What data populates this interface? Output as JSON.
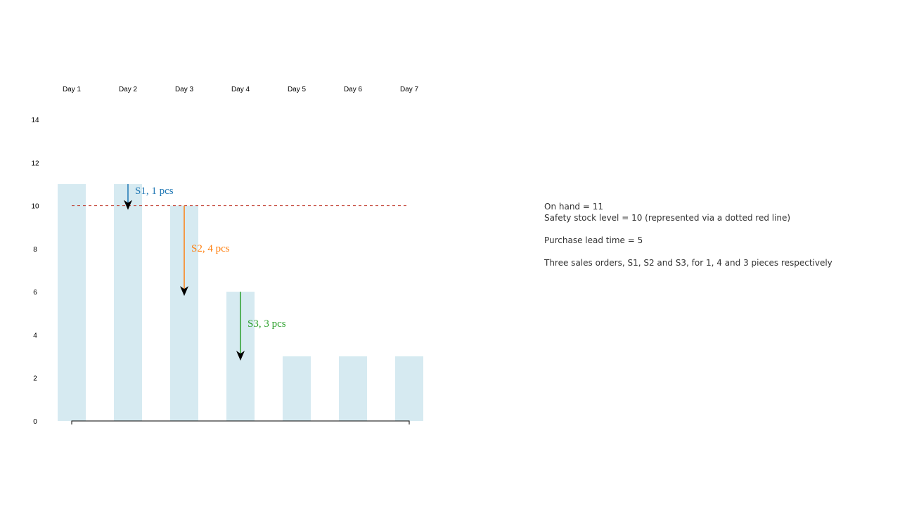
{
  "chart_data": {
    "type": "bar",
    "categories": [
      "Day 1",
      "Day 2",
      "Day 3",
      "Day 4",
      "Day 5",
      "Day 6",
      "Day 7"
    ],
    "values": [
      11,
      11,
      10,
      6,
      3,
      3,
      3
    ],
    "ylim": [
      0,
      14
    ],
    "yticks": [
      0,
      2,
      4,
      6,
      8,
      10,
      12,
      14
    ],
    "grid": false,
    "safety_stock_line": 10,
    "bar_color": "#d6eaf1",
    "safety_line_color": "#c0392b",
    "annotations": [
      {
        "text": "S1, 1 pcs",
        "category": "Day 2",
        "from": 11,
        "to": 10,
        "color": "#1f77b4"
      },
      {
        "text": "S2, 4 pcs",
        "category": "Day 3",
        "from": 10,
        "to": 6,
        "color": "#ff7f0e"
      },
      {
        "text": "S3, 3 pcs",
        "category": "Day 4",
        "from": 6,
        "to": 3,
        "color": "#2ca02c"
      }
    ]
  },
  "notes": {
    "on_hand": "On hand = 11",
    "safety_stock": "Safety stock level = 10 (represented via a dotted red line)",
    "lead_time": "Purchase lead time = 5",
    "sales_orders": "Three sales orders, S1, S2 and S3, for 1, 4 and 3 pieces respectively"
  }
}
